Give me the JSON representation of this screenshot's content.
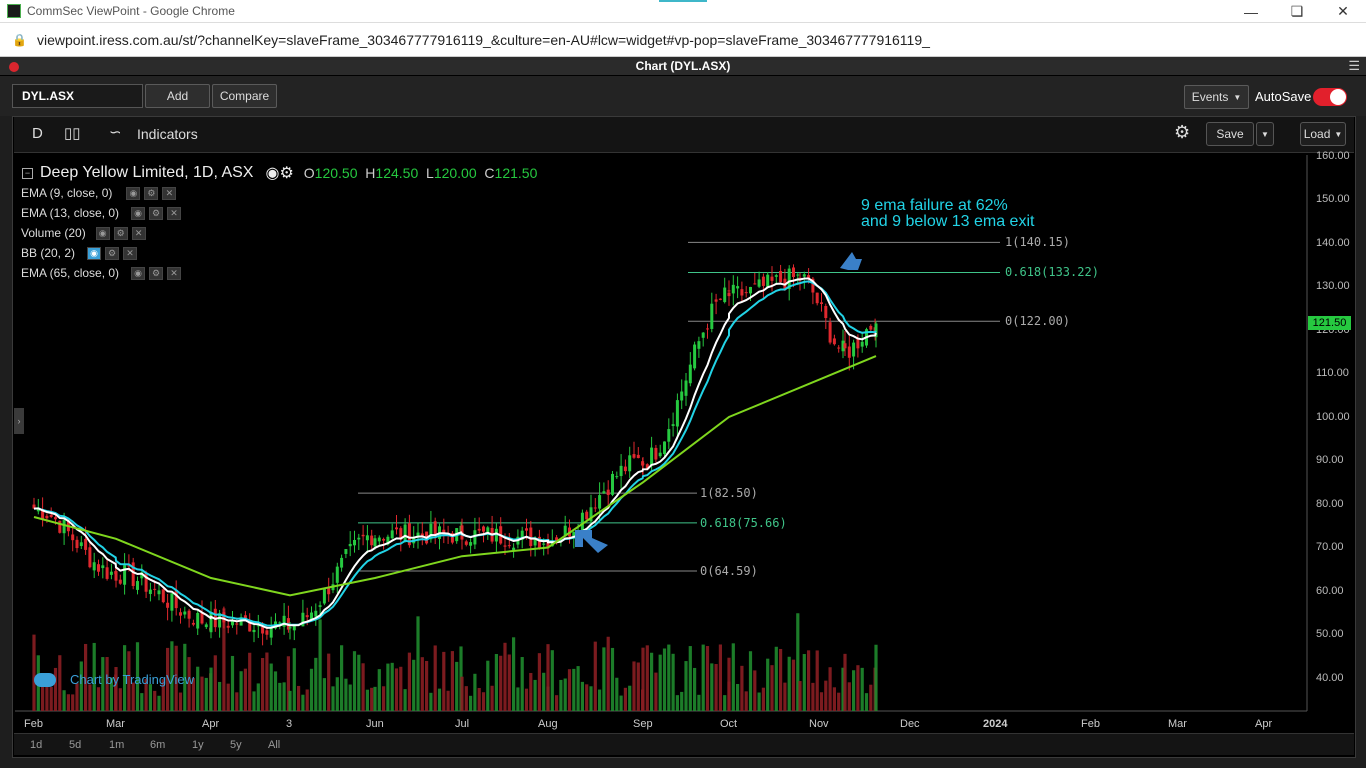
{
  "browser": {
    "window_title": "CommSec ViewPoint - Google Chrome",
    "url": "viewpoint.iress.com.au/st/?channelKey=slaveFrame_303467777916119_&culture=en-AU#lcw=widget#vp-pop=slaveFrame_303467777916119_"
  },
  "panel": {
    "title": "Chart (DYL.ASX)"
  },
  "toolbar": {
    "symbol": "DYL.ASX",
    "add_label": "Add",
    "compare_label": "Compare",
    "events_label": "Events",
    "autosave_label": "AutoSave",
    "autosave_on": true
  },
  "chart_toolbar": {
    "interval": "D",
    "indicators_label": "Indicators",
    "save_label": "Save",
    "load_label": "Load"
  },
  "legend": {
    "name": "Deep Yellow Limited, 1D, ASX",
    "o_label": "O",
    "o_value": "120.50",
    "h_label": "H",
    "h_value": "124.50",
    "l_label": "L",
    "l_value": "120.00",
    "c_label": "C",
    "c_value": "121.50",
    "studies": [
      "EMA (9, close, 0)",
      "EMA (13, close, 0)",
      "Volume (20)",
      "BB (20, 2)",
      "EMA (65, close, 0)"
    ]
  },
  "annotation": {
    "line1": "9 ema failure at 62%",
    "line2": "and 9 below 13 ema exit"
  },
  "fib_upper": {
    "top": "1(140.15)",
    "mid": "0.618(133.22)",
    "bottom": "0(122.00)"
  },
  "fib_lower": {
    "top": "1(82.50)",
    "mid": "0.618(75.66)",
    "bottom": "0(64.59)"
  },
  "last_price_badge": "121.50",
  "watermark": "Chart by TradingView",
  "range_buttons": [
    "1d",
    "5d",
    "1m",
    "6m",
    "1y",
    "5y",
    "All"
  ],
  "colors": {
    "up": "#26c940",
    "down": "#e0282e",
    "ema9": "#ffffff",
    "ema13": "#22d3e6",
    "ema65": "#7fd61e",
    "annotation": "#22d3e6",
    "fib_mid": "#3fc489"
  },
  "chart_data": {
    "type": "candlestick",
    "title": "Deep Yellow Limited, 1D, ASX",
    "ylim": [
      35,
      163
    ],
    "y_ticks": [
      "160.00",
      "150.00",
      "140.00",
      "130.00",
      "120.00",
      "110.00",
      "100.00",
      "90.00",
      "80.00",
      "70.00",
      "60.00",
      "50.00",
      "40.00"
    ],
    "x_ticks": [
      "Feb",
      "Mar",
      "Apr",
      "3",
      "Jun",
      "Jul",
      "Aug",
      "Sep",
      "Oct",
      "Nov",
      "Dec",
      "2024",
      "Feb",
      "Mar",
      "Apr"
    ],
    "close_path": [
      [
        "Feb",
        79
      ],
      [
        "Mar",
        64
      ],
      [
        "Apr",
        53
      ],
      [
        "3",
        52
      ],
      [
        "Jun",
        73
      ],
      [
        "Jul",
        73
      ],
      [
        "Aug",
        72
      ],
      [
        "Sep",
        90
      ],
      [
        "Oct",
        128
      ],
      [
        "Nov",
        132
      ],
      [
        "Nov",
        115
      ],
      [
        "Nov",
        121.5
      ]
    ],
    "ema65_path": [
      [
        "Feb",
        77
      ],
      [
        "Mar",
        72
      ],
      [
        "Apr",
        63
      ],
      [
        "3",
        59
      ],
      [
        "Jun",
        63
      ],
      [
        "Jul",
        68
      ],
      [
        "Aug",
        70
      ],
      [
        "Sep",
        85
      ],
      [
        "Oct",
        100
      ],
      [
        "Nov",
        114
      ]
    ],
    "fib_levels": [
      {
        "label": "1(140.15)",
        "value": 140.15
      },
      {
        "label": "0.618(133.22)",
        "value": 133.22
      },
      {
        "label": "0(122.00)",
        "value": 122.0
      },
      {
        "label": "1(82.50)",
        "value": 82.5
      },
      {
        "label": "0.618(75.66)",
        "value": 75.66
      },
      {
        "label": "0(64.59)",
        "value": 64.59
      }
    ]
  }
}
